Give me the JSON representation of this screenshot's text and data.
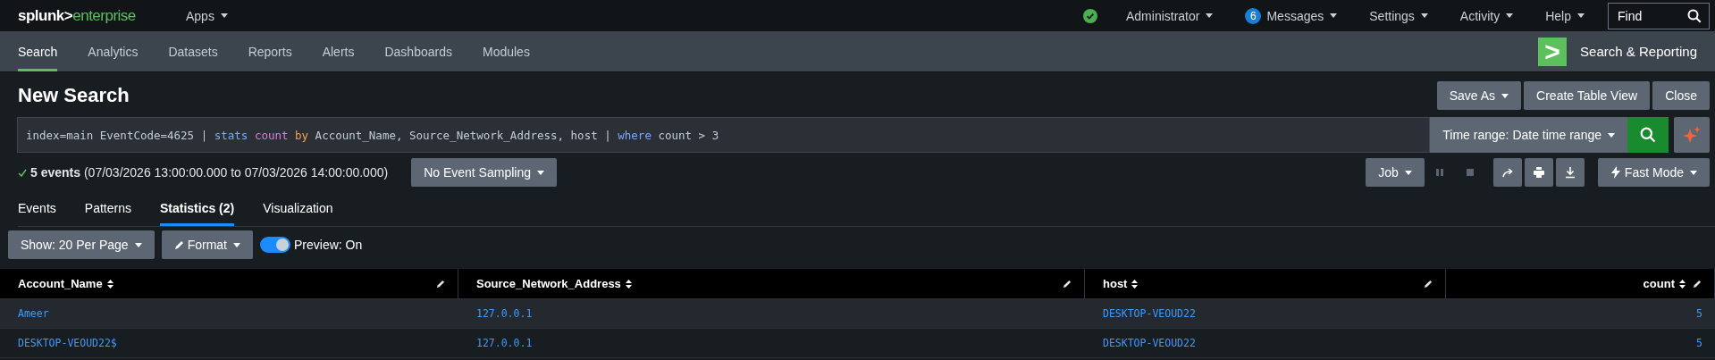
{
  "top_bar": {
    "logo_left": "splunk>",
    "logo_right": "enterprise",
    "apps_menu": "Apps",
    "status_ok": true,
    "menus": [
      {
        "label": "Administrator"
      },
      {
        "label": "Messages",
        "badge": "6"
      },
      {
        "label": "Settings"
      },
      {
        "label": "Activity"
      },
      {
        "label": "Help"
      }
    ],
    "find": {
      "placeholder": "Find"
    }
  },
  "app_nav": {
    "items": [
      {
        "label": "Search",
        "selected": true
      },
      {
        "label": "Analytics",
        "selected": false
      },
      {
        "label": "Datasets",
        "selected": false
      },
      {
        "label": "Reports",
        "selected": false
      },
      {
        "label": "Alerts",
        "selected": false
      },
      {
        "label": "Dashboards",
        "selected": false
      },
      {
        "label": "Modules",
        "selected": false
      }
    ],
    "app_icon": ">",
    "app_name": "Search & Reporting"
  },
  "title": "New Search",
  "header_buttons": [
    "Save As",
    "Create Table View",
    "Close"
  ],
  "query": [
    {
      "kind": "plain",
      "text": "index=main EventCode=4625 | "
    },
    {
      "kind": "command",
      "text": "stats"
    },
    {
      "kind": "function",
      "text": " count"
    },
    {
      "kind": "keyword",
      "text": " by"
    },
    {
      "kind": "plain",
      "text": " Account_Name, Source_Network_Address, host | "
    },
    {
      "kind": "command",
      "text": "where"
    },
    {
      "kind": "plain",
      "text": " count > 3"
    }
  ],
  "time_range": "Time range: Date time range",
  "status": {
    "done": true,
    "count": "5 events",
    "range": "(07/03/2026 13:00:00.000 to 07/03/2026 14:00:00.000)"
  },
  "sampling": "No Event Sampling",
  "job_menu": "Job",
  "mode": "Fast Mode",
  "result_tabs": [
    {
      "label": "Events",
      "selected": false
    },
    {
      "label": "Patterns",
      "selected": false
    },
    {
      "label": "Statistics (2)",
      "selected": true
    },
    {
      "label": "Visualization",
      "selected": false
    }
  ],
  "toolbar": {
    "per_page": "Show: 20 Per Page",
    "format": "Format",
    "preview": {
      "label": "Preview: On",
      "on": true
    }
  },
  "table": {
    "columns": [
      "Account_Name",
      "Source_Network_Address",
      "host",
      "count"
    ],
    "rows": [
      [
        "Ameer",
        "127.0.0.1",
        "DESKTOP-VEOUD22",
        "5"
      ],
      [
        "DESKTOP-VEOUD22$",
        "127.0.0.1",
        "DESKTOP-VEOUD22",
        "5"
      ]
    ]
  }
}
